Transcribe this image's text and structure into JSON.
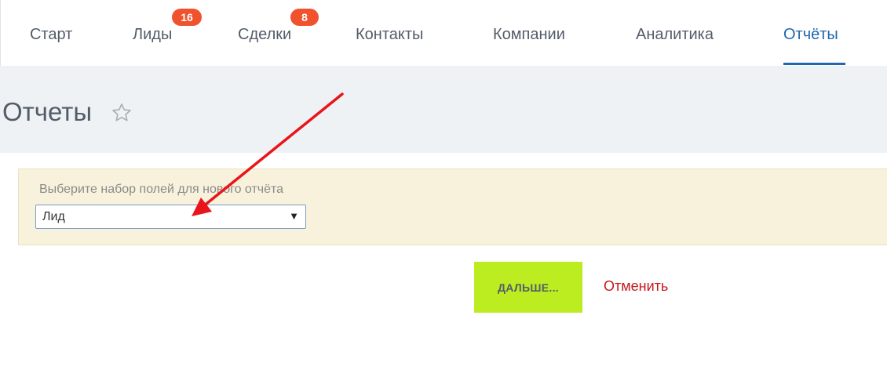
{
  "nav": {
    "tabs": [
      {
        "label": "Старт"
      },
      {
        "label": "Лиды",
        "badge": "16"
      },
      {
        "label": "Сделки",
        "badge": "8"
      },
      {
        "label": "Контакты"
      },
      {
        "label": "Компании"
      },
      {
        "label": "Аналитика"
      },
      {
        "label": "Отчёты",
        "active": true
      }
    ]
  },
  "page": {
    "title": "Отчеты"
  },
  "form": {
    "label": "Выберите набор полей для нового отчёта",
    "select_value": "Лид",
    "next_label": "ДАЛЬШЕ...",
    "cancel_label": "Отменить"
  },
  "colors": {
    "accent": "#2067b0",
    "badge": "#f0522e",
    "next_button": "#bbed21",
    "cancel": "#c4171c",
    "annotation_arrow": "#e8151b"
  },
  "icons": {
    "star": "star-outline-icon",
    "dropdown": "triangle-down-icon",
    "annotation": "red-arrow-annotation"
  }
}
